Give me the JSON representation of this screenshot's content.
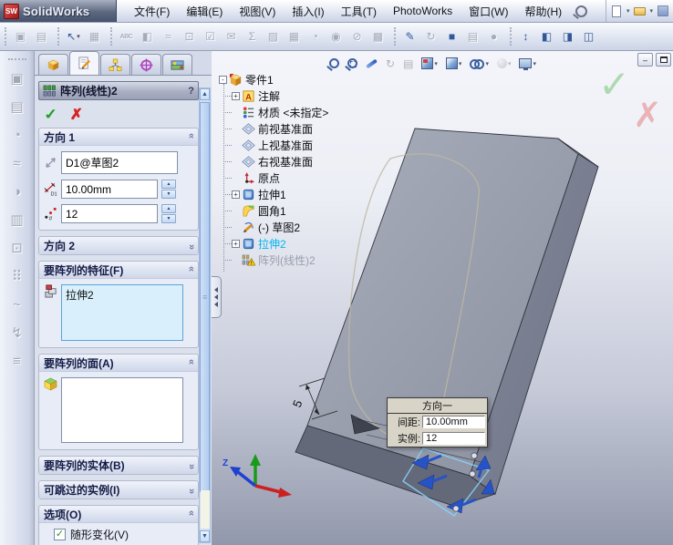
{
  "window": {
    "app_name": "SolidWorks",
    "logo_text": "SW",
    "minimize_glyph": "–"
  },
  "menubar": {
    "items": [
      "文件(F)",
      "编辑(E)",
      "视图(V)",
      "插入(I)",
      "工具(T)",
      "PhotoWorks",
      "窗口(W)",
      "帮助(H)"
    ]
  },
  "toolbar": {
    "groups": [
      {
        "icons": [
          {
            "name": "insert-components-icon",
            "glyph": "▣",
            "enabled": false
          },
          {
            "name": "smart-fasteners-icon",
            "glyph": "▤",
            "enabled": false
          }
        ]
      },
      {
        "icons": [
          {
            "name": "select-cursor-icon",
            "glyph": "↖",
            "enabled": true,
            "dropdown": true
          },
          {
            "name": "selection-filter-icon",
            "glyph": "▦",
            "enabled": false
          }
        ]
      },
      {
        "icons": [
          {
            "name": "spell-checker-icon",
            "glyph": "ABC",
            "enabled": false,
            "abc": true
          },
          {
            "name": "design-checker-icon",
            "glyph": "◧",
            "enabled": false
          },
          {
            "name": "measure-icon",
            "glyph": "≈",
            "enabled": false
          },
          {
            "name": "mass-properties-icon",
            "glyph": "⊡",
            "enabled": false
          },
          {
            "name": "check-entity-icon",
            "glyph": "☑",
            "enabled": false
          },
          {
            "name": "deviation-analysis-icon",
            "glyph": "✉",
            "enabled": false
          },
          {
            "name": "equations-icon",
            "glyph": "Σ",
            "enabled": false
          },
          {
            "name": "curvature-icon",
            "glyph": "▨",
            "enabled": false
          },
          {
            "name": "design-table-icon",
            "glyph": "▦",
            "enabled": false
          },
          {
            "name": "draft-analysis-icon",
            "glyph": "◔",
            "enabled": false
          },
          {
            "name": "zebra-stripes-icon",
            "glyph": "◉",
            "enabled": false
          },
          {
            "name": "undercut-icon",
            "glyph": "⊘",
            "enabled": false
          },
          {
            "name": "block-icon",
            "glyph": "▩",
            "enabled": false
          }
        ]
      },
      {
        "icons": [
          {
            "name": "instant3d-icon",
            "glyph": "✎",
            "enabled": true
          },
          {
            "name": "rotate-view-icon",
            "glyph": "↻",
            "enabled": false
          },
          {
            "name": "shaded-view-icon",
            "glyph": "■",
            "enabled": true
          },
          {
            "name": "section-view-icon",
            "glyph": "▤",
            "enabled": false
          },
          {
            "name": "render-sphere-icon",
            "glyph": "●",
            "enabled": false
          }
        ]
      },
      {
        "icons": [
          {
            "name": "reference-axis-icon",
            "glyph": "↕",
            "enabled": true
          },
          {
            "name": "view-setting-1-icon",
            "glyph": "◧",
            "enabled": true
          },
          {
            "name": "view-setting-2-icon",
            "glyph": "◨",
            "enabled": true
          },
          {
            "name": "view-setting-3-icon",
            "glyph": "◫",
            "enabled": true
          }
        ]
      }
    ]
  },
  "left_toolbar": {
    "icons": [
      {
        "name": "boss-extrude-icon",
        "glyph": "▣"
      },
      {
        "name": "cut-extrude-icon",
        "glyph": "▤"
      },
      {
        "name": "fillet-tool-icon",
        "glyph": "◔"
      },
      {
        "name": "sweep-icon",
        "glyph": "≈"
      },
      {
        "name": "loft-icon",
        "glyph": "◑"
      },
      {
        "name": "shell-icon",
        "glyph": "▥"
      },
      {
        "name": "hole-wizard-icon",
        "glyph": "⊡"
      },
      {
        "name": "linear-pattern-icon",
        "glyph": "⠿"
      },
      {
        "name": "curve-icon",
        "glyph": "~"
      },
      {
        "name": "flex-icon",
        "glyph": "↯"
      },
      {
        "name": "rib-icon",
        "glyph": "≡"
      }
    ]
  },
  "property_manager": {
    "tabs": [
      {
        "name": "tab-features",
        "icon": "features-icon",
        "selected": false
      },
      {
        "name": "tab-property-manager",
        "icon": "property-editor-icon",
        "selected": true
      },
      {
        "name": "tab-configurations",
        "icon": "configurations-icon",
        "selected": false
      },
      {
        "name": "tab-dimxpert",
        "icon": "crosshair-icon",
        "selected": false
      },
      {
        "name": "tab-appearances",
        "icon": "appearance-icon",
        "selected": false
      }
    ],
    "header": {
      "title": "阵列(线性)2",
      "help": "?"
    },
    "actions": {
      "ok_glyph": "✓",
      "cancel_glyph": "✗"
    },
    "groups": {
      "direction1": {
        "label": "方向 1",
        "collapsed": false,
        "fields": {
          "pattern_direction": "D1@草图2",
          "spacing": "10.00mm",
          "instances": "12"
        }
      },
      "direction2": {
        "label": "方向 2",
        "collapsed": true
      },
      "features": {
        "label": "要阵列的特征(F)",
        "collapsed": false,
        "items": [
          "拉伸2"
        ]
      },
      "faces": {
        "label": "要阵列的面(A)",
        "collapsed": false,
        "items": []
      },
      "bodies": {
        "label": "要阵列的实体(B)",
        "collapsed": true
      },
      "skip_instances": {
        "label": "可跳过的实例(I)",
        "collapsed": true
      },
      "options": {
        "label": "选项(O)",
        "collapsed": false,
        "checkbox_label": "随形变化(V)",
        "checked": true
      }
    }
  },
  "feature_tree": {
    "items": [
      {
        "label": "零件1",
        "icon": "part-icon",
        "expand": "-",
        "indent": 0,
        "state": "normal"
      },
      {
        "label": "注解",
        "icon": "annotations-icon",
        "expand": "+",
        "indent": 1,
        "state": "normal"
      },
      {
        "label": "材质 <未指定>",
        "icon": "material-icon",
        "expand": null,
        "indent": 1,
        "state": "normal"
      },
      {
        "label": "前视基准面",
        "icon": "plane-icon",
        "expand": null,
        "indent": 1,
        "state": "normal"
      },
      {
        "label": "上视基准面",
        "icon": "plane-icon",
        "expand": null,
        "indent": 1,
        "state": "normal"
      },
      {
        "label": "右视基准面",
        "icon": "plane-icon",
        "expand": null,
        "indent": 1,
        "state": "normal"
      },
      {
        "label": "原点",
        "icon": "origin-icon",
        "expand": null,
        "indent": 1,
        "state": "normal"
      },
      {
        "label": "拉伸1",
        "icon": "extrude-icon",
        "expand": "+",
        "indent": 1,
        "state": "normal"
      },
      {
        "label": "圆角1",
        "icon": "fillet-icon",
        "expand": null,
        "indent": 1,
        "state": "normal"
      },
      {
        "label": "(-) 草图2",
        "icon": "sketch-icon",
        "expand": null,
        "indent": 1,
        "state": "normal"
      },
      {
        "label": "拉伸2",
        "icon": "extrude-icon",
        "expand": "+",
        "indent": 1,
        "state": "selected"
      },
      {
        "label": "阵列(线性)2",
        "icon": "pattern-warning-icon",
        "expand": null,
        "indent": 1,
        "state": "pending"
      }
    ]
  },
  "viewport": {
    "callout": {
      "title": "方向一",
      "rows": [
        {
          "label": "间距:",
          "value": "10.00mm"
        },
        {
          "label": "实例:",
          "value": "12"
        }
      ]
    },
    "dimension_label": "5",
    "triad": {
      "z": "Z"
    }
  },
  "colors": {
    "selection_cyan": "#00b6f2",
    "preview_arrow_blue": "#2753c8",
    "confirm_green": "#78c378",
    "confirm_red": "#e48282"
  }
}
